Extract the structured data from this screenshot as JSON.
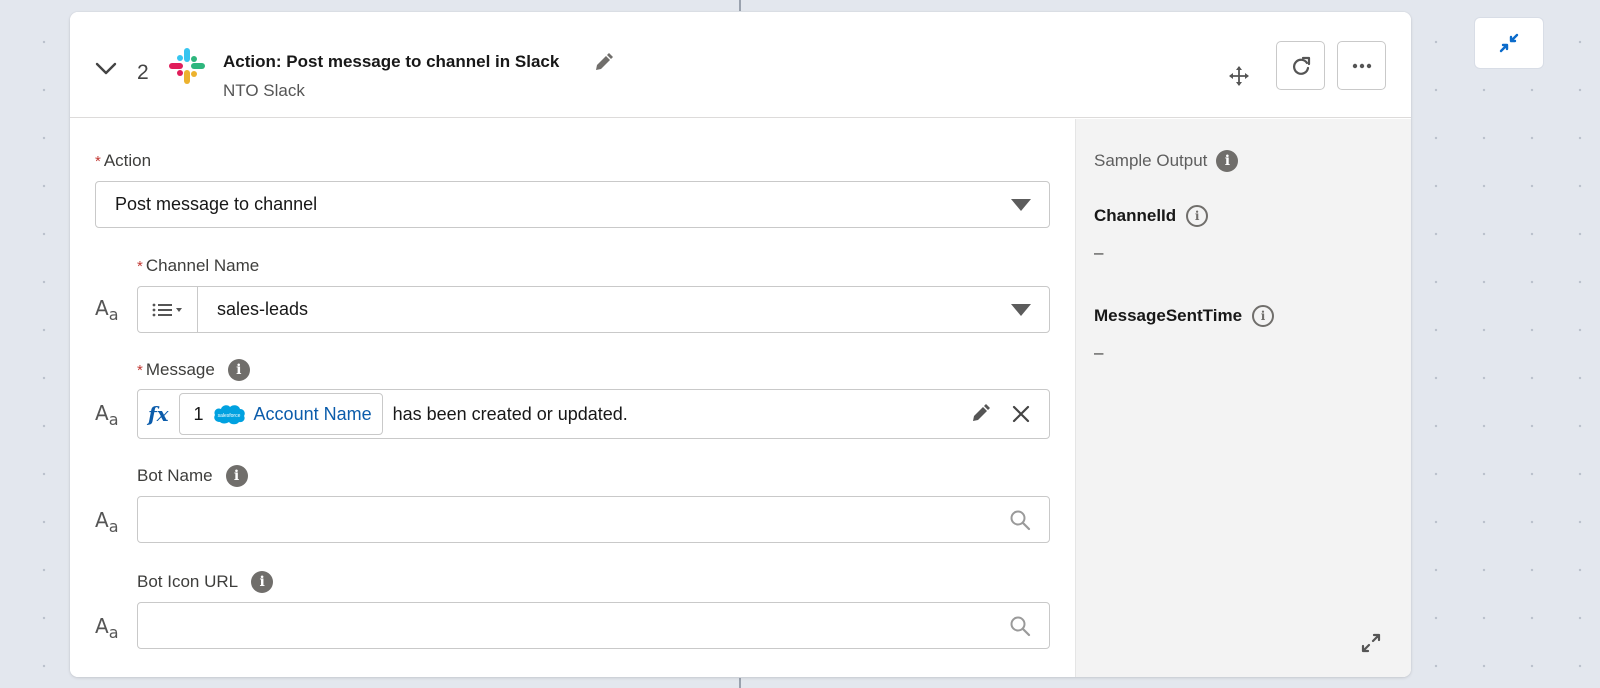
{
  "step": {
    "number": "2",
    "title": "Action: Post message to channel in Slack",
    "subtitle": "NTO Slack",
    "icons": {
      "collapse": "chevron-down-icon",
      "logo": "slack-logo",
      "edit": "pencil-icon",
      "move": "move-icon",
      "refresh": "refresh-icon",
      "more": "more-icon",
      "collapse_view": "minimize-icon"
    }
  },
  "form": {
    "action": {
      "label": "Action",
      "required_mark": "*",
      "value": "Post message to channel"
    },
    "channel": {
      "label": "Channel Name",
      "required_mark": "*",
      "type_icon": "A",
      "type_icon_sub": "a",
      "value": "sales-leads"
    },
    "message": {
      "label": "Message",
      "required_mark": "*",
      "type_icon": "A",
      "type_icon_sub": "a",
      "fx": "fx",
      "pill_number": "1",
      "pill_text": "Account Name",
      "pill_logo_text": "salesforce",
      "text": "has been created or updated."
    },
    "bot_name": {
      "label": "Bot Name",
      "type_icon": "A",
      "type_icon_sub": "a",
      "value": ""
    },
    "bot_icon_url": {
      "label": "Bot Icon URL",
      "type_icon": "A",
      "type_icon_sub": "a",
      "value": ""
    },
    "info_glyph": "i"
  },
  "sample_output": {
    "title": "Sample Output",
    "fields": [
      {
        "name": "ChannelId",
        "value": "–"
      },
      {
        "name": "MessageSentTime",
        "value": "–"
      }
    ]
  },
  "colors": {
    "link": "#0b5cab",
    "required": "#c23934",
    "canvas": "#e3e7ee",
    "panel": "#f3f3f3"
  }
}
